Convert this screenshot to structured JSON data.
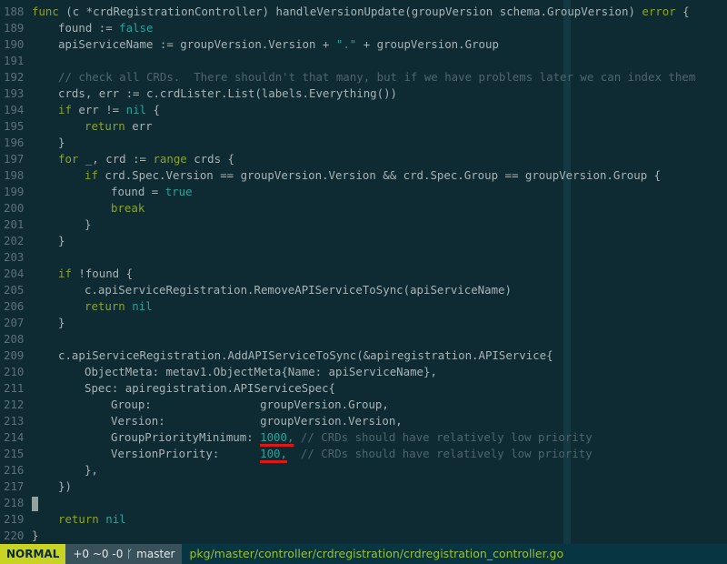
{
  "editor": {
    "lines": [
      {
        "n": "188",
        "indent": 0,
        "parts": [
          {
            "t": "func",
            "c": "kw"
          },
          {
            "t": " (c *crdRegistrationController) handleVersionUpdate(groupVersion schema.GroupVersion) "
          },
          {
            "t": "error",
            "c": "kw"
          },
          {
            "t": " {"
          }
        ]
      },
      {
        "n": "189",
        "indent": 1,
        "parts": [
          {
            "t": "found := "
          },
          {
            "t": "false",
            "c": "num"
          }
        ]
      },
      {
        "n": "190",
        "indent": 1,
        "parts": [
          {
            "t": "apiServiceName := groupVersion.Version + "
          },
          {
            "t": "\".\"",
            "c": "str"
          },
          {
            "t": " + groupVersion.Group"
          }
        ]
      },
      {
        "n": "191",
        "indent": 0,
        "parts": []
      },
      {
        "n": "192",
        "indent": 1,
        "parts": [
          {
            "t": "// check all CRDs.  There shouldn't that many, but if we have problems later we can index them",
            "c": "cm"
          }
        ]
      },
      {
        "n": "193",
        "indent": 1,
        "parts": [
          {
            "t": "crds, err := c.crdLister.List(labels.Everything())"
          }
        ]
      },
      {
        "n": "194",
        "indent": 1,
        "parts": [
          {
            "t": "if",
            "c": "kw"
          },
          {
            "t": " err != "
          },
          {
            "t": "nil",
            "c": "num"
          },
          {
            "t": " {"
          }
        ]
      },
      {
        "n": "195",
        "indent": 2,
        "parts": [
          {
            "t": "return",
            "c": "kw"
          },
          {
            "t": " err"
          }
        ]
      },
      {
        "n": "196",
        "indent": 1,
        "parts": [
          {
            "t": "}"
          }
        ]
      },
      {
        "n": "197",
        "indent": 1,
        "parts": [
          {
            "t": "for",
            "c": "kw"
          },
          {
            "t": " _, crd := "
          },
          {
            "t": "range",
            "c": "kw"
          },
          {
            "t": " crds {"
          }
        ]
      },
      {
        "n": "198",
        "indent": 2,
        "parts": [
          {
            "t": "if",
            "c": "kw"
          },
          {
            "t": " crd.Spec.Version == groupVersion.Version && crd.Spec.Group == groupVersion.Group {"
          }
        ]
      },
      {
        "n": "199",
        "indent": 3,
        "parts": [
          {
            "t": "found = "
          },
          {
            "t": "true",
            "c": "num"
          }
        ]
      },
      {
        "n": "200",
        "indent": 3,
        "parts": [
          {
            "t": "break",
            "c": "kw"
          }
        ]
      },
      {
        "n": "201",
        "indent": 2,
        "parts": [
          {
            "t": "}"
          }
        ]
      },
      {
        "n": "202",
        "indent": 1,
        "parts": [
          {
            "t": "}"
          }
        ]
      },
      {
        "n": "203",
        "indent": 0,
        "parts": []
      },
      {
        "n": "204",
        "indent": 1,
        "parts": [
          {
            "t": "if",
            "c": "kw"
          },
          {
            "t": " !found {"
          }
        ]
      },
      {
        "n": "205",
        "indent": 2,
        "parts": [
          {
            "t": "c.apiServiceRegistration.RemoveAPIServiceToSync(apiServiceName)"
          }
        ]
      },
      {
        "n": "206",
        "indent": 2,
        "parts": [
          {
            "t": "return",
            "c": "kw"
          },
          {
            "t": " "
          },
          {
            "t": "nil",
            "c": "num"
          }
        ]
      },
      {
        "n": "207",
        "indent": 1,
        "parts": [
          {
            "t": "}"
          }
        ]
      },
      {
        "n": "208",
        "indent": 0,
        "parts": []
      },
      {
        "n": "209",
        "indent": 1,
        "parts": [
          {
            "t": "c.apiServiceRegistration.AddAPIServiceToSync(&apiregistration.APIService{"
          }
        ]
      },
      {
        "n": "210",
        "indent": 2,
        "parts": [
          {
            "t": "ObjectMeta: metav1.ObjectMeta{Name: apiServiceName},"
          }
        ]
      },
      {
        "n": "211",
        "indent": 2,
        "parts": [
          {
            "t": "Spec: apiregistration.APIServiceSpec{"
          }
        ]
      },
      {
        "n": "212",
        "indent": 3,
        "parts": [
          {
            "t": "Group:                groupVersion.Group,"
          }
        ]
      },
      {
        "n": "213",
        "indent": 3,
        "parts": [
          {
            "t": "Version:              groupVersion.Version,"
          }
        ]
      },
      {
        "n": "214",
        "indent": 3,
        "parts": [
          {
            "t": "GroupPriorityMinimum: "
          },
          {
            "t": "1000,",
            "c": "num",
            "mark": true
          },
          {
            "t": " "
          },
          {
            "t": "// CRDs should have relatively low priority",
            "c": "cm"
          }
        ]
      },
      {
        "n": "215",
        "indent": 3,
        "parts": [
          {
            "t": "VersionPriority:      "
          },
          {
            "t": "100,",
            "c": "num",
            "mark": true
          },
          {
            "t": "  "
          },
          {
            "t": "// CRDs should have relatively low priority",
            "c": "cm"
          }
        ]
      },
      {
        "n": "216",
        "indent": 2,
        "parts": [
          {
            "t": "},"
          }
        ]
      },
      {
        "n": "217",
        "indent": 1,
        "parts": [
          {
            "t": "})"
          }
        ]
      },
      {
        "n": "218",
        "indent": 0,
        "parts": [],
        "cursor": true
      },
      {
        "n": "219",
        "indent": 1,
        "parts": [
          {
            "t": "return",
            "c": "kw"
          },
          {
            "t": " "
          },
          {
            "t": "nil",
            "c": "num"
          }
        ]
      },
      {
        "n": "220",
        "indent": 0,
        "parts": [
          {
            "t": "}"
          }
        ]
      }
    ]
  },
  "statusbar": {
    "mode": "NORMAL",
    "git": "+0 ~0 -0 ᚴ master",
    "filepath": "pkg/master/controller/crdregistration/crdregistration_controller.go"
  },
  "colors": {
    "background": "#0e2b34",
    "keyword": "#8aa32c",
    "comment": "#4d666d",
    "constant": "#2aa198",
    "mode_bg": "#c8d421",
    "annotation_underline": "#e01717"
  }
}
